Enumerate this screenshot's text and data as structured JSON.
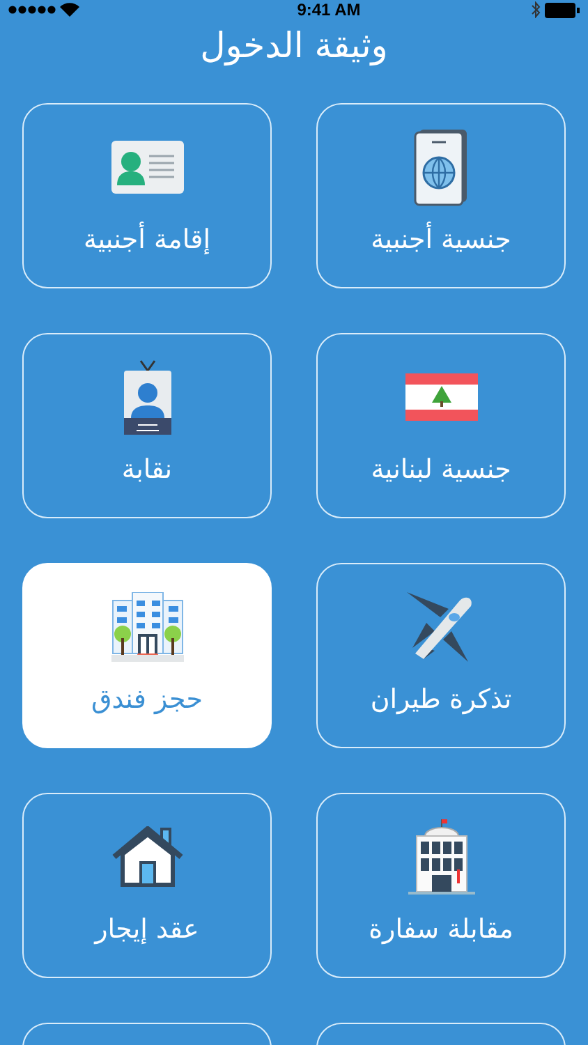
{
  "status_bar": {
    "time": "9:41 AM"
  },
  "header": {
    "title": "وثيقة الدخول"
  },
  "services": [
    {
      "label": "جنسية أجنبية",
      "kind": "passport",
      "selected": false
    },
    {
      "label": "إقامة أجنبية",
      "kind": "id-card",
      "selected": false
    },
    {
      "label": "جنسية لبنانية",
      "kind": "flag",
      "selected": false
    },
    {
      "label": "نقابة",
      "kind": "badge",
      "selected": false
    },
    {
      "label": "تذكرة طيران",
      "kind": "plane",
      "selected": false
    },
    {
      "label": "حجز فندق",
      "kind": "hotel",
      "selected": true
    },
    {
      "label": "مقابلة سفارة",
      "kind": "embassy",
      "selected": false
    },
    {
      "label": "عقد إيجار",
      "kind": "house",
      "selected": false
    },
    {
      "kind": "blank",
      "selected": false
    },
    {
      "kind": "blank",
      "selected": false
    }
  ]
}
